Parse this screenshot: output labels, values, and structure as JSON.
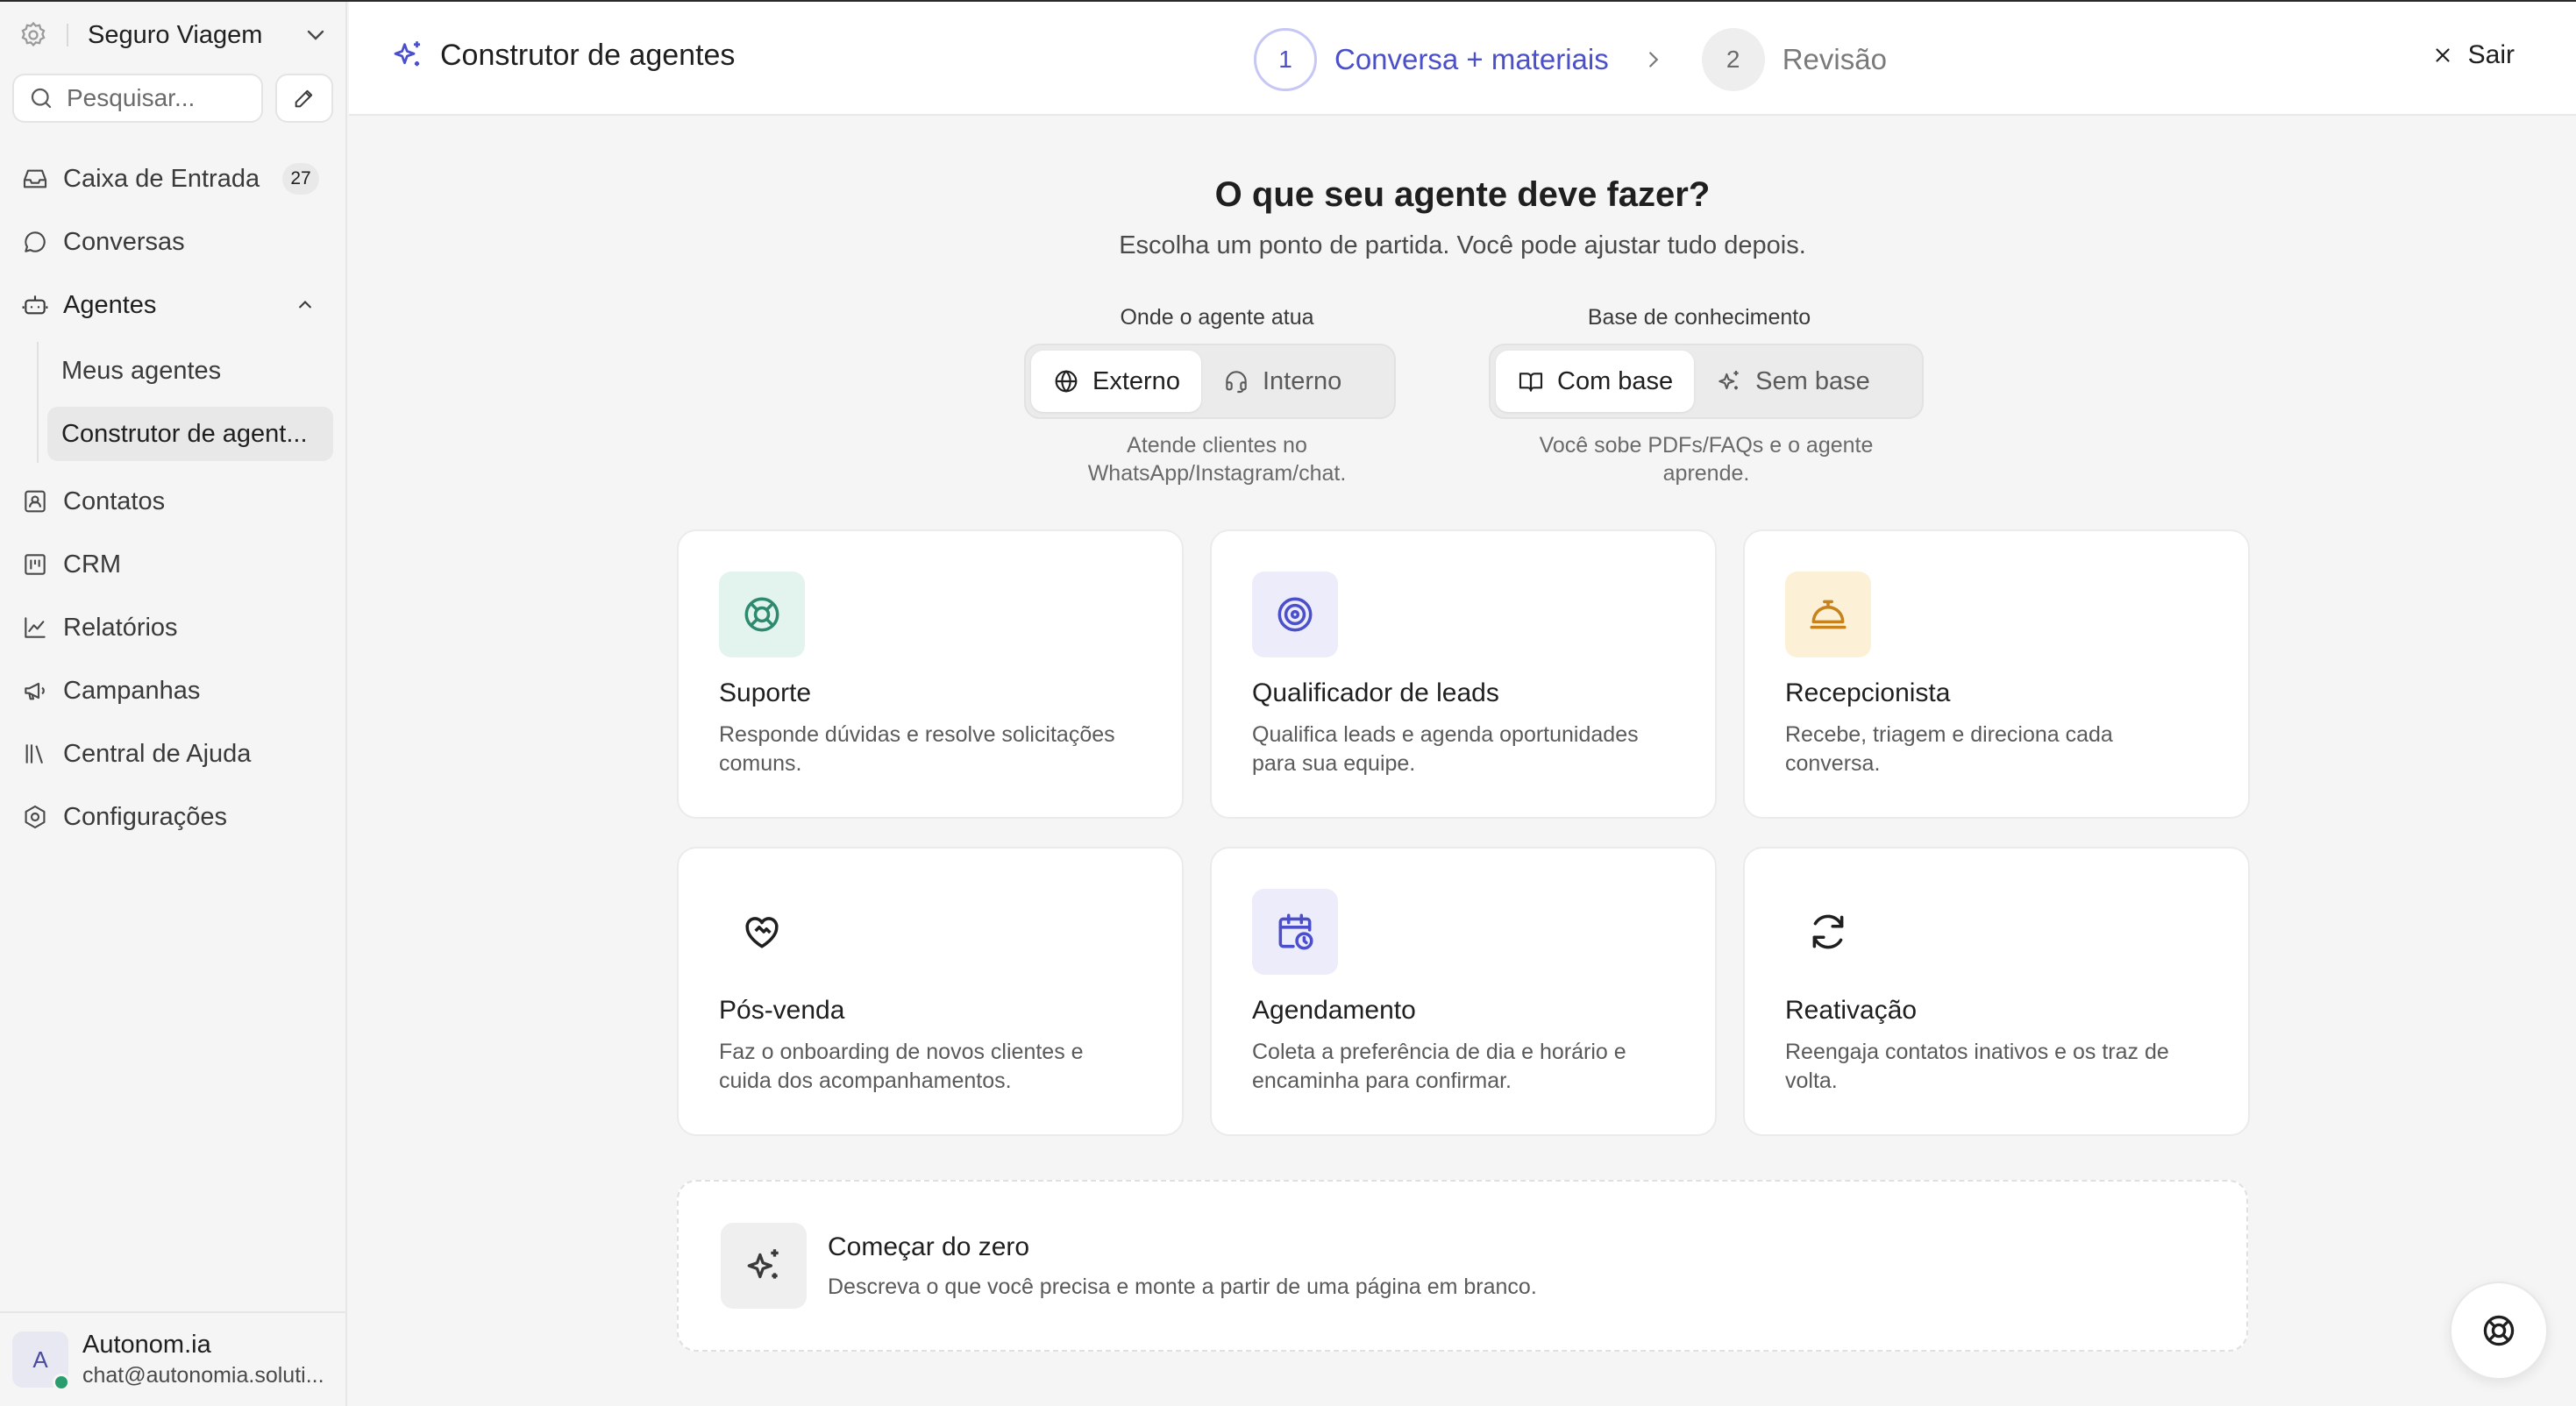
{
  "workspace": {
    "name": "Seguro Viagem",
    "logo_icon": "gear-logo-icon"
  },
  "search": {
    "placeholder": "Pesquisar..."
  },
  "sidebar": {
    "items": [
      {
        "label": "Caixa de Entrada",
        "icon": "inbox-icon",
        "badge": "27"
      },
      {
        "label": "Conversas",
        "icon": "chat-bubble-icon"
      },
      {
        "label": "Agentes",
        "icon": "bot-icon",
        "expanded": true
      },
      {
        "label": "Contatos",
        "icon": "contact-card-icon"
      },
      {
        "label": "CRM",
        "icon": "kanban-icon"
      },
      {
        "label": "Relatórios",
        "icon": "line-chart-icon"
      },
      {
        "label": "Campanhas",
        "icon": "megaphone-icon"
      },
      {
        "label": "Central de Ajuda",
        "icon": "library-icon"
      },
      {
        "label": "Configurações",
        "icon": "settings-icon"
      }
    ],
    "subitems": [
      {
        "label": "Meus agentes"
      },
      {
        "label": "Construtor de agent..."
      }
    ]
  },
  "user": {
    "initial": "A",
    "name": "Autonom.ia",
    "email": "chat@autonomia.soluti..."
  },
  "header": {
    "title": "Construtor de agentes",
    "steps": [
      {
        "number": "1",
        "label": "Conversa + materiais",
        "active": true
      },
      {
        "number": "2",
        "label": "Revisão",
        "active": false
      }
    ],
    "exit_label": "Sair"
  },
  "main": {
    "title": "O que seu agente deve fazer?",
    "subtitle": "Escolha um ponto de partida. Você pode ajustar tudo depois.",
    "scope": {
      "label": "Onde o agente atua",
      "options": [
        "Externo",
        "Interno"
      ],
      "selected": "Externo",
      "hint_line1": "Atende clientes no",
      "hint_line2": "WhatsApp/Instagram/chat."
    },
    "knowledge": {
      "label": "Base de conhecimento",
      "options": [
        "Com base",
        "Sem base"
      ],
      "selected": "Com base",
      "hint_line1": "Você sobe PDFs/FAQs e o agente",
      "hint_line2": "aprende."
    },
    "templates": [
      {
        "title": "Suporte",
        "desc_line1": "Responde dúvidas e resolve solicitações",
        "desc_line2": "comuns.",
        "icon": "lifebuoy-icon",
        "color": "#2e8a6e",
        "bg": "#e3f3ee"
      },
      {
        "title": "Qualificador de leads",
        "desc_line1": "Qualifica leads e agenda oportunidades",
        "desc_line2": "para sua equipe.",
        "icon": "target-icon",
        "color": "#4b4fc9",
        "bg": "#ececfa"
      },
      {
        "title": "Recepcionista",
        "desc_line1": "Recebe, triagem e direciona cada",
        "desc_line2": "conversa.",
        "icon": "concierge-bell-icon",
        "color": "#c7821c",
        "bg": "#fcf1d6"
      },
      {
        "title": "Pós-venda",
        "desc_line1": "Faz o onboarding de novos clientes e",
        "desc_line2": "cuida dos acompanhamentos.",
        "icon": "handshake-heart-icon",
        "color": "#1f1f1f",
        "bg": "#ffffff"
      },
      {
        "title": "Agendamento",
        "desc_line1": "Coleta a preferência de dia e horário e",
        "desc_line2": "encaminha para confirmar.",
        "icon": "calendar-clock-icon",
        "color": "#4b4fc9",
        "bg": "#ececfa"
      },
      {
        "title": "Reativação",
        "desc_line1": "Reengaja contatos inativos e os traz de",
        "desc_line2": "volta.",
        "icon": "refresh-icon",
        "color": "#1f1f1f",
        "bg": "#ffffff"
      }
    ],
    "scratch": {
      "title": "Começar do zero",
      "desc": "Descreva o que você precisa e monte a partir de uma página em branco.",
      "icon": "sparkles-icon"
    }
  },
  "colors": {
    "accent": "#4b4fc9",
    "accent_light": "#c6c7f5",
    "online": "#2a9d6e"
  }
}
